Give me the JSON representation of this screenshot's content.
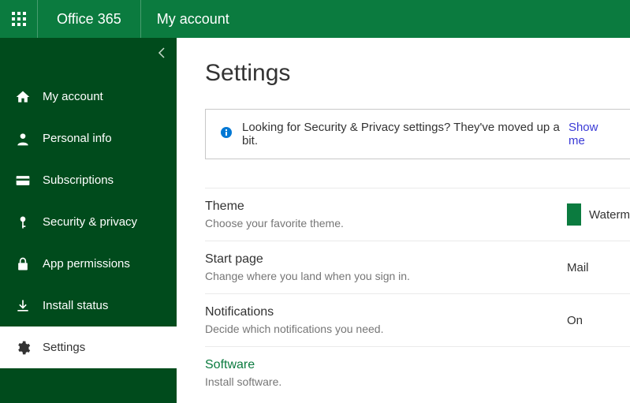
{
  "header": {
    "brand": "Office 365",
    "page": "My account"
  },
  "sidebar": {
    "items": [
      {
        "label": "My account"
      },
      {
        "label": "Personal info"
      },
      {
        "label": "Subscriptions"
      },
      {
        "label": "Security & privacy"
      },
      {
        "label": "App permissions"
      },
      {
        "label": "Install status"
      },
      {
        "label": "Settings"
      }
    ]
  },
  "main": {
    "heading": "Settings",
    "banner_text": "Looking for Security & Privacy settings? They've moved up a bit.",
    "banner_link": "Show me",
    "settings": {
      "theme": {
        "title": "Theme",
        "sub": "Choose your favorite theme.",
        "value": "Waterm",
        "swatch": "#0b7b3f"
      },
      "start": {
        "title": "Start page",
        "sub": "Change where you land when you sign in.",
        "value": "Mail"
      },
      "notifications": {
        "title": "Notifications",
        "sub": "Decide which notifications you need.",
        "value": "On"
      },
      "software": {
        "title": "Software",
        "sub": "Install software."
      }
    }
  }
}
